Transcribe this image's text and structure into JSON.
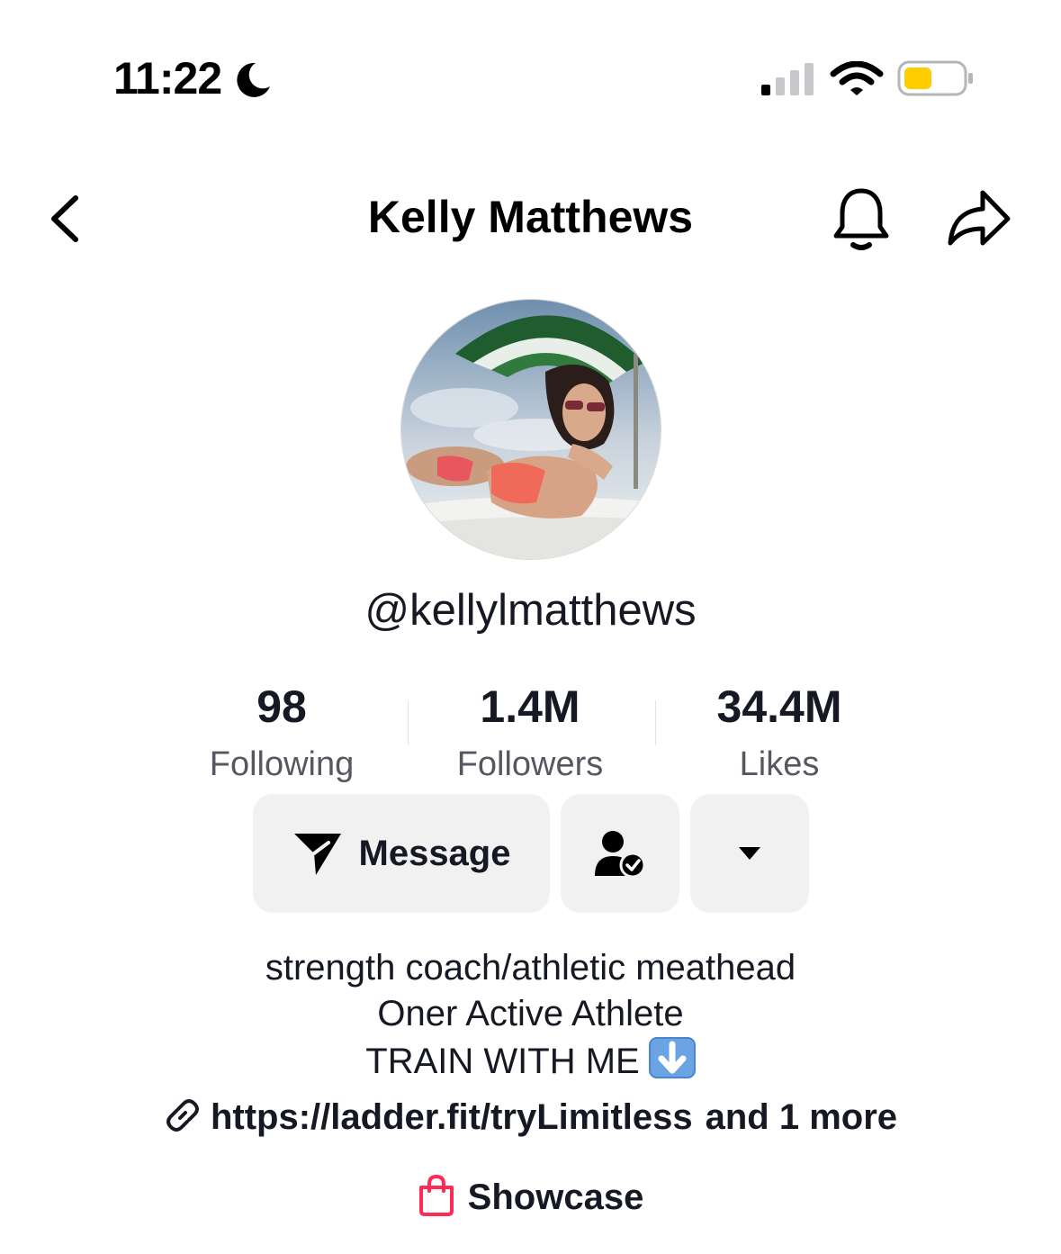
{
  "status_bar": {
    "time": "11:22",
    "battery_color": "#FFCC00",
    "icons": [
      "moon-icon",
      "signal-icon",
      "wifi-icon",
      "battery-icon"
    ]
  },
  "header": {
    "title": "Kelly Matthews",
    "icons": [
      "back-chevron-icon",
      "bell-icon",
      "share-arrow-icon"
    ]
  },
  "profile": {
    "username": "@kellylmatthews",
    "stats": [
      {
        "value": "98",
        "label": "Following"
      },
      {
        "value": "1.4M",
        "label": "Followers"
      },
      {
        "value": "34.4M",
        "label": "Likes"
      }
    ],
    "buttons": {
      "message_label": "Message",
      "friend_icon": "user-check-icon",
      "more_icon": "caret-down-icon"
    },
    "bio_lines": [
      "strength coach/athletic meathead",
      "Oner Active Athlete",
      "TRAIN WITH ME"
    ],
    "bio_emoji": "down-arrow-emoji-icon",
    "link": {
      "url": "https://ladder.fit/tryLimitless",
      "more": "and 1 more"
    },
    "showcase": {
      "label": "Showcase",
      "icon_color": "#FE2C55"
    }
  }
}
